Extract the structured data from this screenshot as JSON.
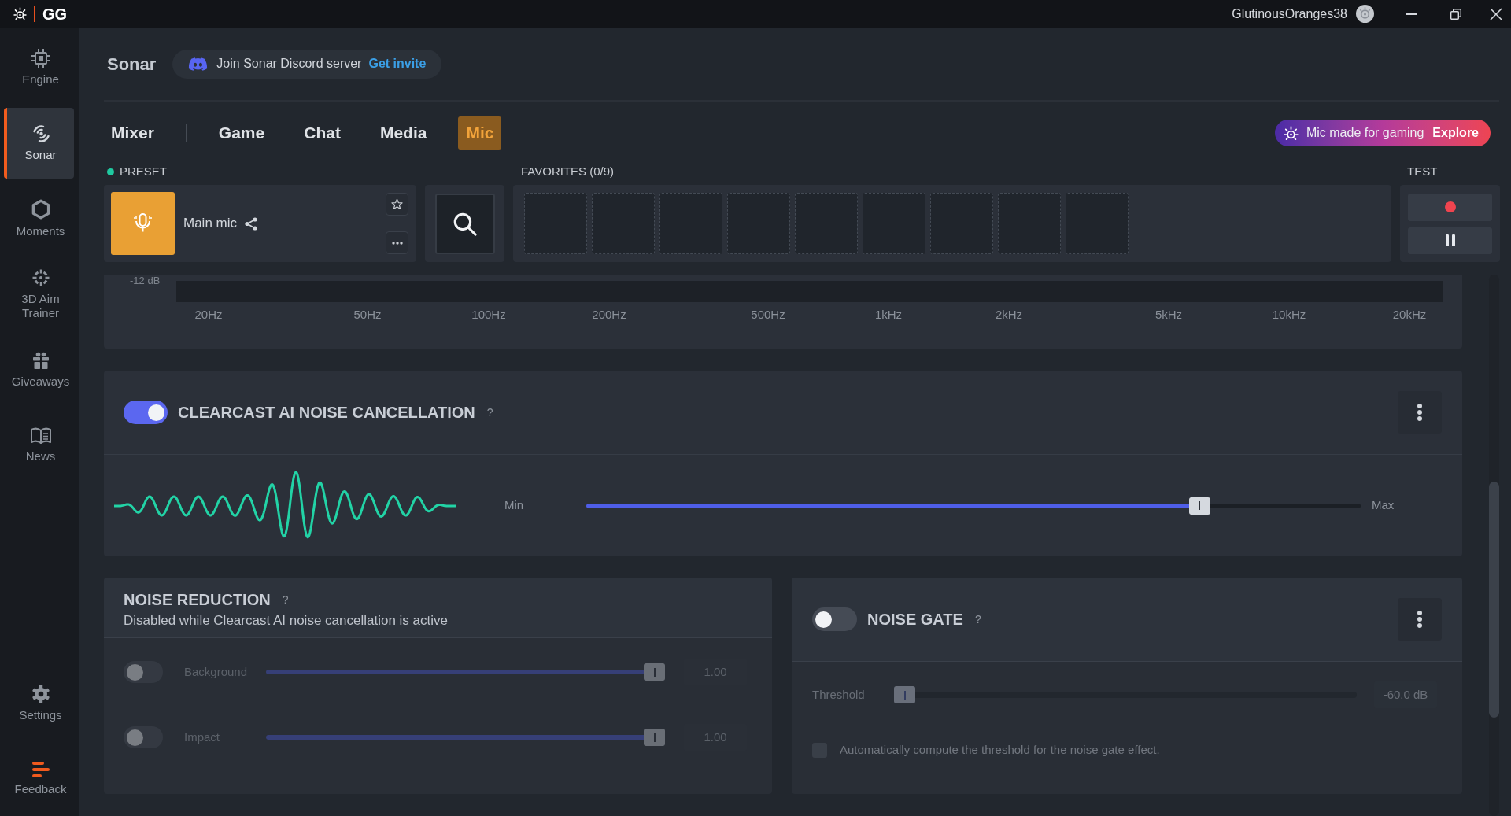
{
  "title_bar": {
    "app_name": "GG",
    "username": "GlutinousOranges38"
  },
  "sidebar": {
    "items": [
      {
        "label": "Engine",
        "selected": false
      },
      {
        "label": "Sonar",
        "selected": true
      },
      {
        "label": "Moments",
        "selected": false
      },
      {
        "label": "3D Aim Trainer",
        "selected": false
      },
      {
        "label": "Giveaways",
        "selected": false
      },
      {
        "label": "News",
        "selected": false
      }
    ],
    "bottom_items": [
      {
        "label": "Settings",
        "selected": false
      },
      {
        "label": "Feedback",
        "selected": false
      }
    ]
  },
  "header": {
    "title": "Sonar",
    "discord_banner": {
      "text": "Join Sonar Discord server",
      "link": "Get invite"
    }
  },
  "tabs": [
    {
      "label": "Mixer",
      "selected": false
    },
    {
      "label": "Game",
      "selected": false
    },
    {
      "label": "Chat",
      "selected": false
    },
    {
      "label": "Media",
      "selected": false
    },
    {
      "label": "Mic",
      "selected": true
    }
  ],
  "promo": {
    "text": "Mic made for gaming",
    "link": "Explore"
  },
  "preset": {
    "label": "PRESET",
    "name": "Main mic"
  },
  "favorites": {
    "label": "FAVORITES (0/9)"
  },
  "test": {
    "label": "TEST"
  },
  "equalizer": {
    "gain_label": "-12 dB",
    "frequency_labels": [
      "20Hz",
      "50Hz",
      "100Hz",
      "200Hz",
      "500Hz",
      "1kHz",
      "2kHz",
      "5kHz",
      "10kHz",
      "20kHz"
    ]
  },
  "clearcast": {
    "on": true,
    "title": "CLEARCAST AI NOISE CANCELLATION",
    "help": "?",
    "min_label": "Min",
    "max_label": "Max",
    "level": 0.8
  },
  "noise_reduction": {
    "title": "NOISE REDUCTION",
    "help": "?",
    "subtitle": "Disabled while Clearcast AI noise cancellation is active",
    "disabled": true,
    "rows": [
      {
        "label": "Background",
        "on": false,
        "level": 1,
        "value": "1.00"
      },
      {
        "label": "Impact",
        "on": false,
        "level": 1,
        "value": "1.00"
      }
    ]
  },
  "noise_gate": {
    "on": false,
    "title": "NOISE GATE",
    "help": "?",
    "threshold": {
      "label": "Threshold",
      "level": 0,
      "value": "-60.0 dB"
    },
    "auto_threshold": {
      "label": "Automatically compute the threshold for the noise gate effect.",
      "checked": false
    }
  }
}
